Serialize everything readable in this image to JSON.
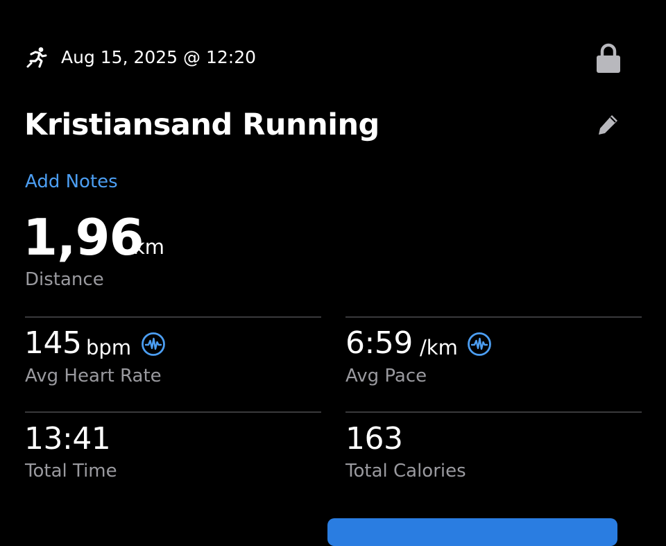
{
  "activity": {
    "icon": "running-icon",
    "datetime": "Aug 15, 2025 @ 12:20",
    "title": "Kristiansand Running",
    "add_notes_label": "Add Notes"
  },
  "distance": {
    "value": "1,96",
    "unit": "km",
    "label": "Distance"
  },
  "metrics": {
    "heart_rate": {
      "value": "145",
      "unit": "bpm",
      "label": "Avg Heart Rate",
      "icon": "chart-wave-icon"
    },
    "pace": {
      "value": "6:59",
      "unit": "/km",
      "label": "Avg Pace",
      "icon": "chart-wave-icon"
    },
    "time": {
      "value": "13:41",
      "label": "Total Time"
    },
    "calories": {
      "value": "163",
      "label": "Total Calories"
    }
  },
  "colors": {
    "background": "#000000",
    "accent": "#4c9ef2",
    "label": "#9a9a9f",
    "divider": "#3a3a3c",
    "icon_gray": "#b8b8bd",
    "button": "#2a7de1"
  }
}
